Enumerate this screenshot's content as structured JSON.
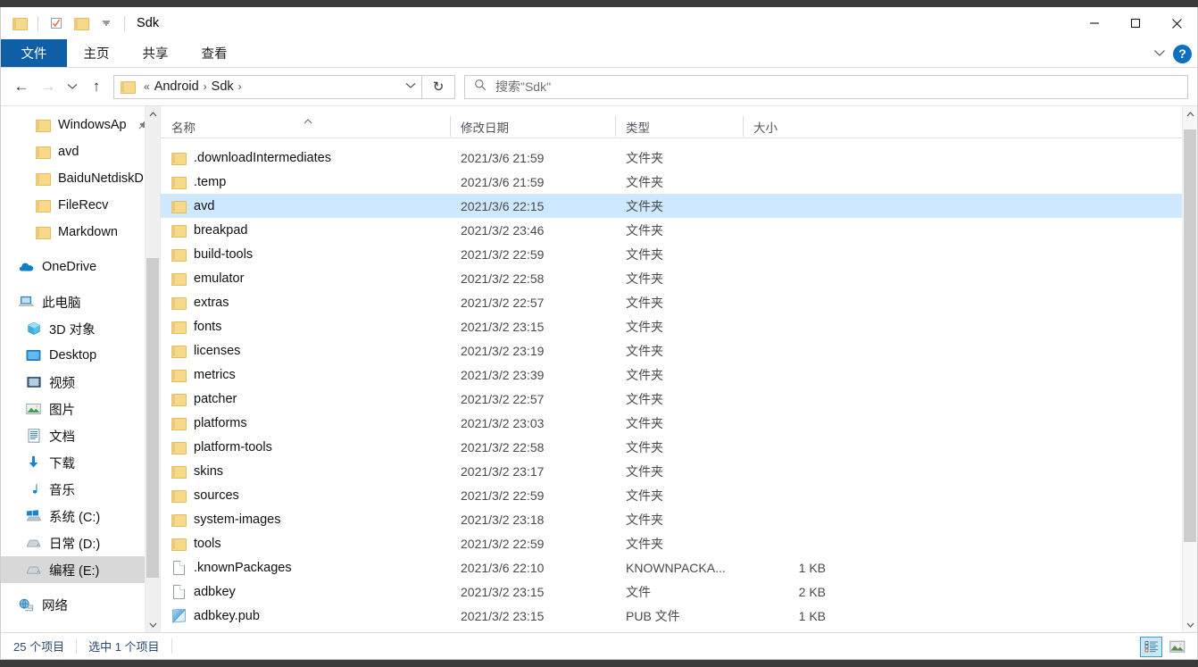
{
  "window": {
    "title": "Sdk",
    "quick_access": [
      {
        "name": "folder-icon",
        "label": "文件资源管理器"
      },
      {
        "name": "properties-icon",
        "label": "属性"
      },
      {
        "name": "new-folder-icon",
        "label": "新建文件夹"
      },
      {
        "name": "chevron-down-icon",
        "label": "自定义快速访问工具栏"
      }
    ],
    "controls": {
      "minimize": "—",
      "maximize": "□",
      "close": "✕"
    }
  },
  "ribbon": {
    "tabs": [
      {
        "id": "file",
        "label": "文件",
        "active": true
      },
      {
        "id": "home",
        "label": "主页",
        "active": false
      },
      {
        "id": "share",
        "label": "共享",
        "active": false
      },
      {
        "id": "view",
        "label": "查看",
        "active": false
      }
    ],
    "collapse_label": "⌄",
    "help_label": "?"
  },
  "address": {
    "back": "←",
    "forward": "→",
    "recent": "⌄",
    "up": "↑",
    "breadcrumb": {
      "overflow": "«",
      "items": [
        "Android",
        "Sdk"
      ],
      "separator": "›",
      "chevron": "⌄"
    },
    "refresh": "↻"
  },
  "search": {
    "icon": "search-icon",
    "placeholder": "搜索\"Sdk\""
  },
  "sidebar": {
    "groups": [
      {
        "items": [
          {
            "label": "WindowsAp",
            "icon": "folder",
            "indent": 1,
            "pinned": true,
            "selected": false
          },
          {
            "label": "avd",
            "icon": "folder",
            "indent": 1,
            "pinned": false,
            "selected": false
          },
          {
            "label": "BaiduNetdiskD",
            "icon": "folder",
            "indent": 1,
            "pinned": false,
            "selected": false
          },
          {
            "label": "FileRecv",
            "icon": "folder",
            "indent": 1,
            "pinned": false,
            "selected": false
          },
          {
            "label": "Markdown",
            "icon": "folder",
            "indent": 1,
            "pinned": false,
            "selected": false
          }
        ]
      },
      {
        "items": [
          {
            "label": "OneDrive",
            "icon": "onedrive",
            "indent": 0,
            "pinned": false,
            "selected": false
          }
        ]
      },
      {
        "items": [
          {
            "label": "此电脑",
            "icon": "thispc",
            "indent": 0,
            "pinned": false,
            "selected": false
          },
          {
            "label": "3D 对象",
            "icon": "3dobjects",
            "indent": 2,
            "pinned": false,
            "selected": false
          },
          {
            "label": "Desktop",
            "icon": "desktop",
            "indent": 2,
            "pinned": false,
            "selected": false
          },
          {
            "label": "视频",
            "icon": "videos",
            "indent": 2,
            "pinned": false,
            "selected": false
          },
          {
            "label": "图片",
            "icon": "pictures",
            "indent": 2,
            "pinned": false,
            "selected": false
          },
          {
            "label": "文档",
            "icon": "documents",
            "indent": 2,
            "pinned": false,
            "selected": false
          },
          {
            "label": "下载",
            "icon": "downloads",
            "indent": 2,
            "pinned": false,
            "selected": false
          },
          {
            "label": "音乐",
            "icon": "music",
            "indent": 2,
            "pinned": false,
            "selected": false
          },
          {
            "label": "系统 (C:)",
            "icon": "windrive",
            "indent": 2,
            "pinned": false,
            "selected": false
          },
          {
            "label": "日常 (D:)",
            "icon": "drive",
            "indent": 2,
            "pinned": false,
            "selected": false
          },
          {
            "label": "编程 (E:)",
            "icon": "drive",
            "indent": 2,
            "pinned": false,
            "selected": true
          }
        ]
      },
      {
        "items": [
          {
            "label": "网络",
            "icon": "network",
            "indent": 0,
            "pinned": false,
            "selected": false
          }
        ]
      }
    ]
  },
  "filelist": {
    "columns": [
      {
        "id": "name",
        "label": "名称",
        "sorted": "asc"
      },
      {
        "id": "date",
        "label": "修改日期",
        "sorted": null
      },
      {
        "id": "type",
        "label": "类型",
        "sorted": null
      },
      {
        "id": "size",
        "label": "大小",
        "sorted": null
      }
    ],
    "sort_caret": "⌃",
    "rows": [
      {
        "name": ".downloadIntermediates",
        "date": "2021/3/6 21:59",
        "type": "文件夹",
        "size": "",
        "icon": "folder",
        "selected": false
      },
      {
        "name": ".temp",
        "date": "2021/3/6 21:59",
        "type": "文件夹",
        "size": "",
        "icon": "folder",
        "selected": false
      },
      {
        "name": "avd",
        "date": "2021/3/6 22:15",
        "type": "文件夹",
        "size": "",
        "icon": "folder",
        "selected": true
      },
      {
        "name": "breakpad",
        "date": "2021/3/2 23:46",
        "type": "文件夹",
        "size": "",
        "icon": "folder",
        "selected": false
      },
      {
        "name": "build-tools",
        "date": "2021/3/2 22:59",
        "type": "文件夹",
        "size": "",
        "icon": "folder",
        "selected": false
      },
      {
        "name": "emulator",
        "date": "2021/3/2 22:58",
        "type": "文件夹",
        "size": "",
        "icon": "folder",
        "selected": false
      },
      {
        "name": "extras",
        "date": "2021/3/2 22:57",
        "type": "文件夹",
        "size": "",
        "icon": "folder",
        "selected": false
      },
      {
        "name": "fonts",
        "date": "2021/3/2 23:15",
        "type": "文件夹",
        "size": "",
        "icon": "folder",
        "selected": false
      },
      {
        "name": "licenses",
        "date": "2021/3/2 23:19",
        "type": "文件夹",
        "size": "",
        "icon": "folder",
        "selected": false
      },
      {
        "name": "metrics",
        "date": "2021/3/2 23:39",
        "type": "文件夹",
        "size": "",
        "icon": "folder",
        "selected": false
      },
      {
        "name": "patcher",
        "date": "2021/3/2 22:57",
        "type": "文件夹",
        "size": "",
        "icon": "folder",
        "selected": false
      },
      {
        "name": "platforms",
        "date": "2021/3/2 23:03",
        "type": "文件夹",
        "size": "",
        "icon": "folder",
        "selected": false
      },
      {
        "name": "platform-tools",
        "date": "2021/3/2 22:58",
        "type": "文件夹",
        "size": "",
        "icon": "folder",
        "selected": false
      },
      {
        "name": "skins",
        "date": "2021/3/2 23:17",
        "type": "文件夹",
        "size": "",
        "icon": "folder",
        "selected": false
      },
      {
        "name": "sources",
        "date": "2021/3/2 22:59",
        "type": "文件夹",
        "size": "",
        "icon": "folder",
        "selected": false
      },
      {
        "name": "system-images",
        "date": "2021/3/2 23:18",
        "type": "文件夹",
        "size": "",
        "icon": "folder",
        "selected": false
      },
      {
        "name": "tools",
        "date": "2021/3/2 22:59",
        "type": "文件夹",
        "size": "",
        "icon": "folder",
        "selected": false
      },
      {
        "name": ".knownPackages",
        "date": "2021/3/6 22:10",
        "type": "KNOWNPACKA...",
        "size": "1 KB",
        "icon": "file",
        "selected": false
      },
      {
        "name": "adbkey",
        "date": "2021/3/2 23:15",
        "type": "文件",
        "size": "2 KB",
        "icon": "file",
        "selected": false
      },
      {
        "name": "adbkey.pub",
        "date": "2021/3/2 23:15",
        "type": "PUB 文件",
        "size": "1 KB",
        "icon": "pub",
        "selected": false
      }
    ]
  },
  "statusbar": {
    "item_count": "25 个项目",
    "selection": "选中 1 个项目",
    "views": [
      {
        "id": "details",
        "label": "详细信息",
        "active": true
      },
      {
        "id": "large-icons",
        "label": "大图标",
        "active": false
      }
    ]
  },
  "colors": {
    "accent": "#0f5fa6",
    "selection": "#cde8ff",
    "folder": "#f7d98b"
  }
}
